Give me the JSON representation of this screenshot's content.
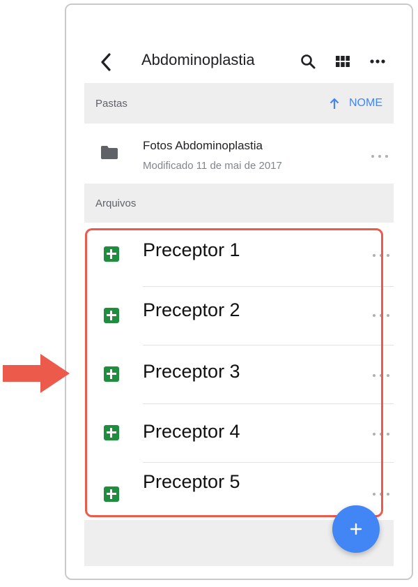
{
  "header": {
    "title": "Abdominoplastia",
    "back_icon": "chevron-left-icon",
    "actions": [
      "search-icon",
      "grid-view-icon",
      "more-icon"
    ]
  },
  "folders_section": {
    "label": "Pastas",
    "sort_icon": "arrow-up-icon",
    "sort_label": "NOME"
  },
  "folders": [
    {
      "name": "Fotos Abdominoplastia",
      "meta": "Modificado 11 de mai de 2017",
      "icon": "folder-icon"
    }
  ],
  "files_section": {
    "label": "Arquivos"
  },
  "files": [
    {
      "name": "Preceptor 1",
      "icon": "sheets-icon"
    },
    {
      "name": "Preceptor 2",
      "icon": "sheets-icon"
    },
    {
      "name": "Preceptor 3",
      "icon": "sheets-icon"
    },
    {
      "name": "Preceptor 4",
      "icon": "sheets-icon"
    },
    {
      "name": "Preceptor 5",
      "icon": "sheets-icon"
    }
  ],
  "fab": {
    "icon": "plus-icon"
  },
  "colors": {
    "accent": "#4285f4",
    "sheets_green": "#1e8e3e",
    "highlight": "#ec5a4c",
    "section_bg": "#eeeeee"
  }
}
